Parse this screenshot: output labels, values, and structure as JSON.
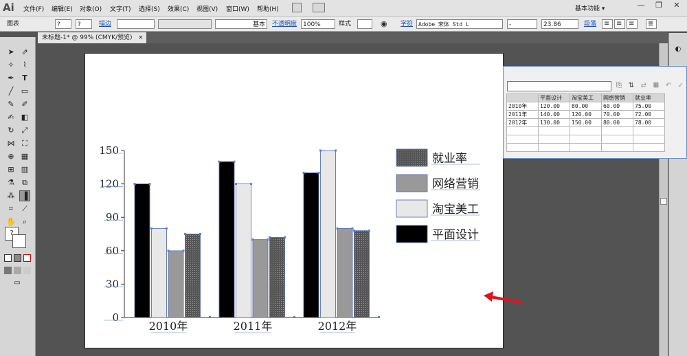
{
  "app": {
    "logo": "Ai",
    "workspace": "基本功能 ▾"
  },
  "menu": [
    "文件(F)",
    "编辑(E)",
    "对象(O)",
    "文字(T)",
    "选择(S)",
    "效果(C)",
    "视图(V)",
    "窗口(W)",
    "帮助(H)"
  ],
  "window_controls": {
    "minimize": "—",
    "restore": "❐",
    "close": "✕"
  },
  "control_bar": {
    "object_type": "图表",
    "fill_value": "?",
    "stroke_value": "?",
    "stroke_label": "描边",
    "stroke_style": "基本",
    "opacity_label": "不透明度",
    "opacity_value": "100%",
    "style_label": "样式",
    "font_label": "字符",
    "font_name": "Adobe 宋体 Std L",
    "font_style": "-",
    "font_size": "23.86",
    "paragraph_label": "段落"
  },
  "document_tab": {
    "title": "未标题-1* @ 99% (CMYK/预览)",
    "close": "×"
  },
  "graph_data": {
    "input_value": "",
    "headers": [
      "",
      "平面设计",
      "淘宝美工",
      "网络营销",
      "就业率"
    ],
    "rows": [
      [
        "2010年",
        "120.00",
        "80.00",
        "60.00",
        "75.00"
      ],
      [
        "2011年",
        "140.00",
        "120.00",
        "70.00",
        "72.00"
      ],
      [
        "2012年",
        "130.00",
        "150.00",
        "80.00",
        "78.00"
      ]
    ]
  },
  "chart_data": {
    "type": "bar",
    "categories": [
      "2010年",
      "2011年",
      "2012年"
    ],
    "series": [
      {
        "name": "平面设计",
        "values": [
          120,
          140,
          130
        ],
        "color": "#000000"
      },
      {
        "name": "淘宝美工",
        "values": [
          80,
          120,
          150
        ],
        "color": "#e8e8e8"
      },
      {
        "name": "网络营销",
        "values": [
          60,
          70,
          80
        ],
        "color": "#999999"
      },
      {
        "name": "就业率",
        "values": [
          75,
          72,
          78
        ],
        "color": "#555555"
      }
    ],
    "legend_order": [
      "就业率",
      "网络营销",
      "淘宝美工",
      "平面设计"
    ],
    "yticks": [
      0,
      30,
      60,
      90,
      120,
      150
    ],
    "ylim": [
      0,
      150
    ],
    "legend_position": "right",
    "grid": false
  }
}
